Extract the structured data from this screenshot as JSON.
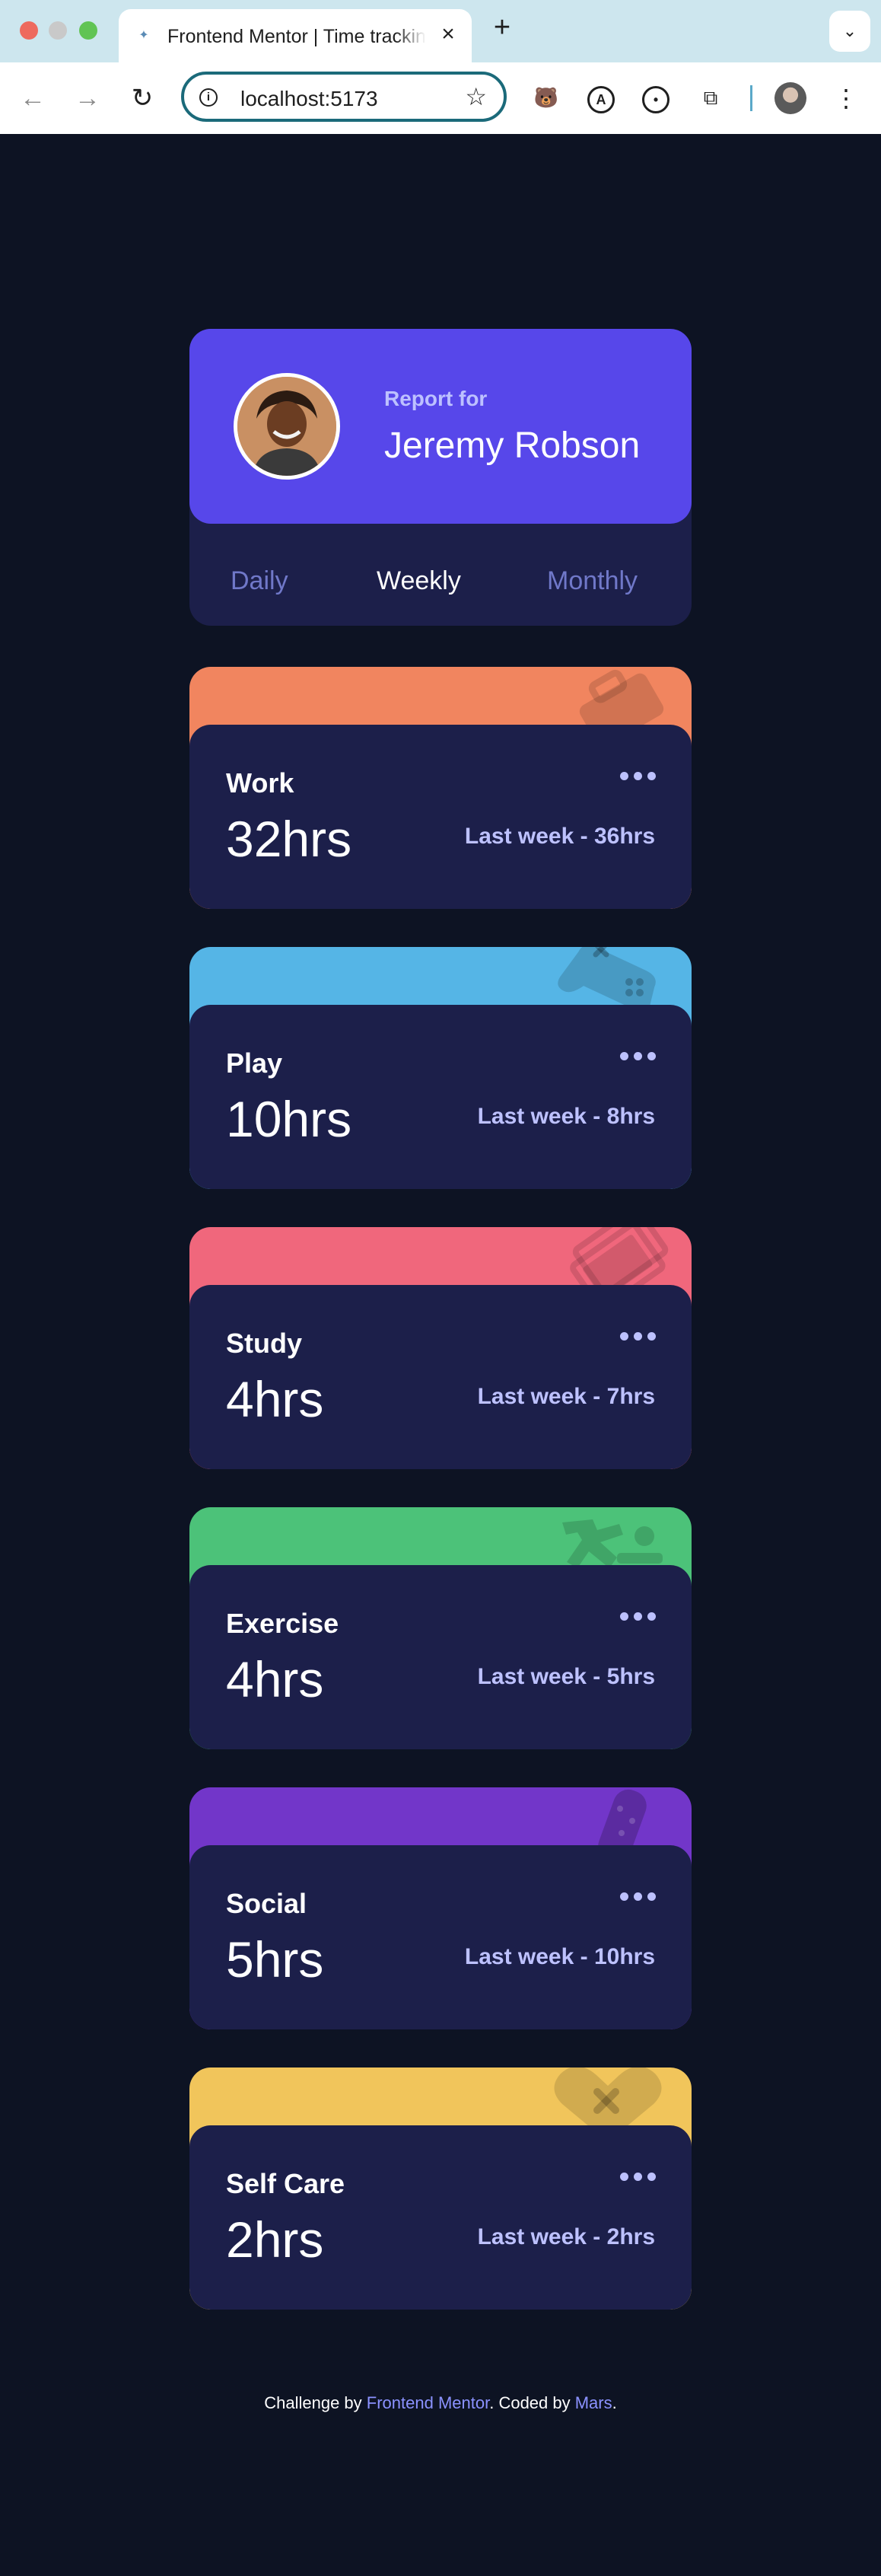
{
  "browser": {
    "tab_title": "Frontend Mentor | Time tracking dashboard",
    "url": "localhost:5173"
  },
  "profile": {
    "report_for": "Report for",
    "name": "Jeremy Robson",
    "periods": [
      "Daily",
      "Weekly",
      "Monthly"
    ],
    "active_period": "Weekly"
  },
  "cards": [
    {
      "title": "Work",
      "current": "32hrs",
      "previous": "Last week - 36hrs",
      "color": "#f1855f",
      "icon": "briefcase-icon"
    },
    {
      "title": "Play",
      "current": "10hrs",
      "previous": "Last week - 8hrs",
      "color": "#55b5e6",
      "icon": "gamepad-icon"
    },
    {
      "title": "Study",
      "current": "4hrs",
      "previous": "Last week - 7hrs",
      "color": "#f0677c",
      "icon": "book-icon"
    },
    {
      "title": "Exercise",
      "current": "4hrs",
      "previous": "Last week - 5hrs",
      "color": "#4cc279",
      "icon": "running-icon"
    },
    {
      "title": "Social",
      "current": "5hrs",
      "previous": "Last week - 10hrs",
      "color": "#7236c9",
      "icon": "social-icon"
    },
    {
      "title": "Self Care",
      "current": "2hrs",
      "previous": "Last week - 2hrs",
      "color": "#f1c55b",
      "icon": "heart-icon"
    }
  ],
  "footer": {
    "prefix": "Challenge by ",
    "link1": "Frontend Mentor",
    "middle": ". Coded by ",
    "link2": "Mars",
    "suffix": "."
  }
}
